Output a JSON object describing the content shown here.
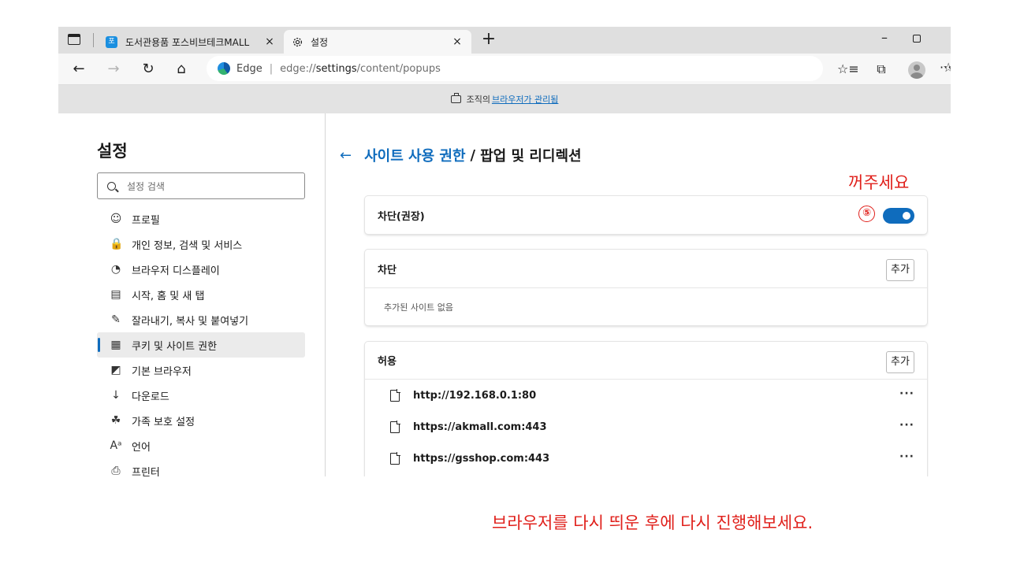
{
  "window": {
    "tabs": [
      {
        "favicon": "포",
        "title": "도서관용품 포스비브테크MALL",
        "close": "×"
      },
      {
        "title": "설정",
        "close": "×"
      }
    ],
    "new_tab": "+",
    "minimize": "–"
  },
  "toolbar": {
    "back": "←",
    "forward": "→",
    "refresh": "↻",
    "home": "⌂",
    "address": {
      "brand": "Edge",
      "separator": "|",
      "scheme": "edge://",
      "path": "settings",
      "rest": "/content/popups"
    },
    "favorite_icon": "☆",
    "favorites_icon": "☆≡",
    "collections_icon": "⧉",
    "more": "···"
  },
  "managed_bar": {
    "prefix": "조직의",
    "link": "브라우저가 관리됨"
  },
  "sidebar": {
    "title": "설정",
    "search_placeholder": "설정 검색",
    "items": [
      {
        "icon": "☺",
        "label": "프로필"
      },
      {
        "icon": "🔒",
        "label": "개인 정보, 검색 및 서비스"
      },
      {
        "icon": "◔",
        "label": "브라우저 디스플레이"
      },
      {
        "icon": "▤",
        "label": "시작, 홈 및 새 탭"
      },
      {
        "icon": "✎",
        "label": "잘라내기, 복사 및 붙여넣기"
      },
      {
        "icon": "▦",
        "label": "쿠키 및 사이트 권한"
      },
      {
        "icon": "◩",
        "label": "기본 브라우저"
      },
      {
        "icon": "↓",
        "label": "다운로드"
      },
      {
        "icon": "☘",
        "label": "가족 보호 설정"
      },
      {
        "icon": "Aᵃ",
        "label": "언어"
      },
      {
        "icon": "⎙",
        "label": "프린터"
      }
    ]
  },
  "main": {
    "back_arrow": "←",
    "crumb_link": "사이트 사용 권한",
    "crumb_sep": "/",
    "crumb_current": "팝업 및 리디렉션",
    "block_recommended": {
      "label": "차단(권장)",
      "enabled": true,
      "step": "⑤"
    },
    "block": {
      "label": "차단",
      "add": "추가",
      "empty": "추가된 사이트 없음"
    },
    "allow": {
      "label": "허용",
      "add": "추가",
      "sites": [
        {
          "url": "http://192.168.0.1:80",
          "more": "···"
        },
        {
          "url": "https://akmall.com:443",
          "more": "···"
        },
        {
          "url": "https://gsshop.com:443",
          "more": "···"
        }
      ]
    }
  },
  "annotations": {
    "turn_off": "꺼주세요",
    "bottom": "브라우저를 다시 띄운 후에 다시 진행해보세요.",
    "color": "#e0201b"
  },
  "colors": {
    "accent": "#0f6cbd"
  }
}
